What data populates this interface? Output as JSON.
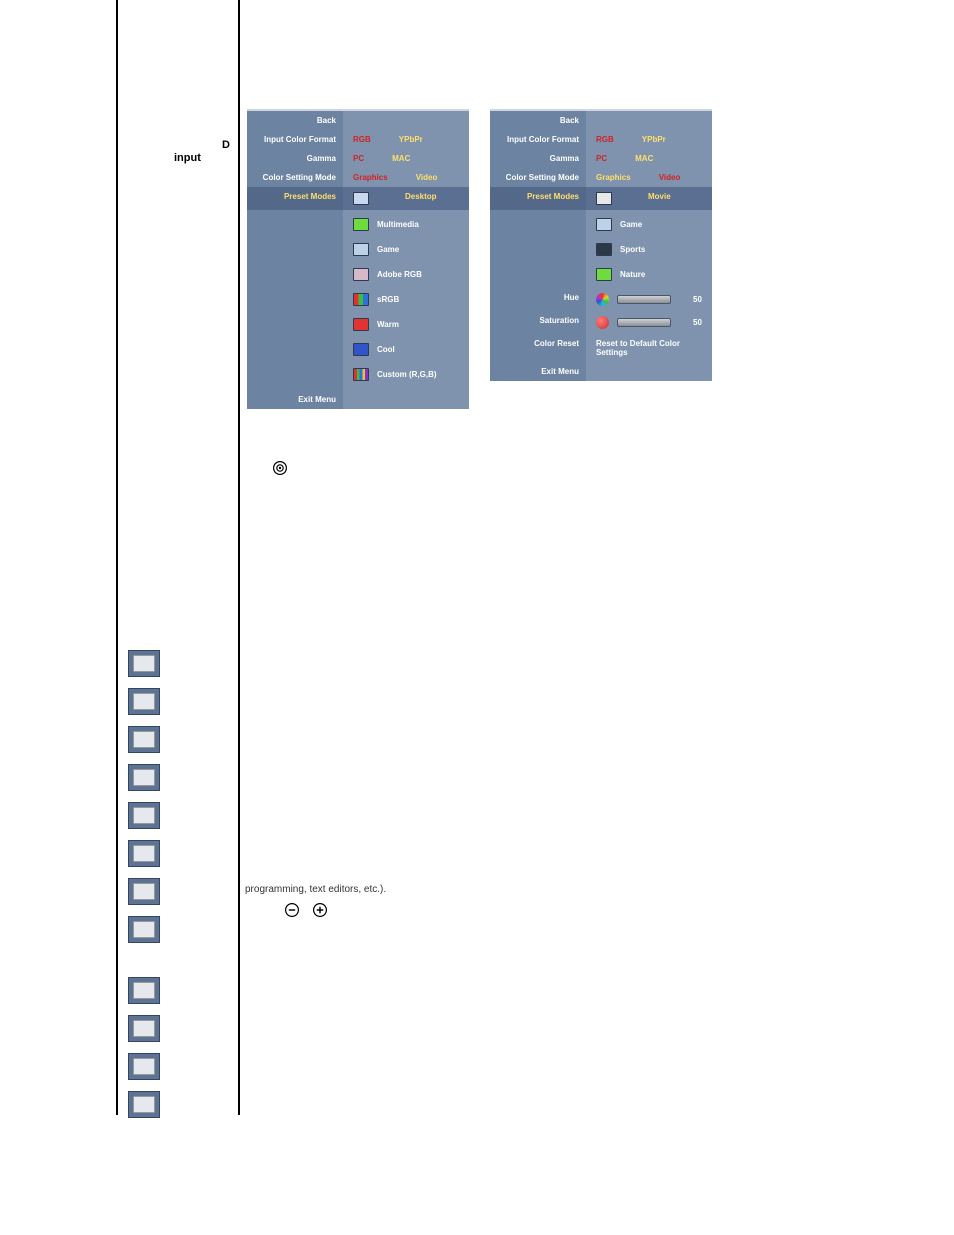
{
  "doc": {
    "d_label": "D",
    "input_label": "input",
    "programming_text": "programming, text editors, etc.)."
  },
  "osd_left": {
    "back": "Back",
    "input_color_format": "Input Color Format",
    "input_color_format_opts": {
      "active": "RGB",
      "other": "YPbPr"
    },
    "gamma": "Gamma",
    "gamma_opts": {
      "active": "PC",
      "other": "MAC"
    },
    "color_setting_mode": "Color Setting Mode",
    "color_setting_mode_opts": {
      "active": "Graphics",
      "other": "Video"
    },
    "preset_modes": "Preset Modes",
    "preset_list": [
      {
        "icon": "desktop-icon",
        "label": "Desktop",
        "highlight": true
      },
      {
        "icon": "multimedia-icon",
        "label": "Multimedia"
      },
      {
        "icon": "game-icon",
        "label": "Game"
      },
      {
        "icon": "adobergb-icon",
        "label": "Adobe RGB"
      },
      {
        "icon": "srgb-icon",
        "label": "sRGB"
      },
      {
        "icon": "warm-icon",
        "label": "Warm"
      },
      {
        "icon": "cool-icon",
        "label": "Cool"
      },
      {
        "icon": "custom-icon",
        "label": "Custom (R,G,B)"
      }
    ],
    "exit_menu": "Exit Menu"
  },
  "osd_right": {
    "back": "Back",
    "input_color_format": "Input Color Format",
    "input_color_format_opts": {
      "active": "RGB",
      "other": "YPbPr"
    },
    "gamma": "Gamma",
    "gamma_opts": {
      "active": "PC",
      "other": "MAC"
    },
    "color_setting_mode": "Color Setting Mode",
    "color_setting_mode_opts": {
      "active": "Graphics",
      "other": "Video",
      "other_active": true
    },
    "preset_modes": "Preset Modes",
    "preset_list": [
      {
        "icon": "movie-icon",
        "label": "Movie",
        "highlight": true
      },
      {
        "icon": "game-icon",
        "label": "Game"
      },
      {
        "icon": "sports-icon",
        "label": "Sports"
      },
      {
        "icon": "nature-icon",
        "label": "Nature"
      }
    ],
    "hue": "Hue",
    "hue_value": "50",
    "saturation": "Saturation",
    "saturation_value": "50",
    "color_reset": "Color Reset",
    "color_reset_action": "Reset to Default Color Settings",
    "exit_menu": "Exit Menu"
  },
  "left_column_icons": {
    "group1": [
      "desktop-icon",
      "multimedia-icon",
      "game-icon",
      "adobergb-icon",
      "srgb-icon",
      "warm-icon",
      "cool-icon",
      "custom-icon"
    ],
    "group2": [
      "movie-icon",
      "game-icon",
      "sports-icon",
      "nature-icon"
    ]
  },
  "body_icons": {
    "single": "target-icon",
    "pair": [
      "minus-circle-icon",
      "plus-circle-icon"
    ]
  }
}
